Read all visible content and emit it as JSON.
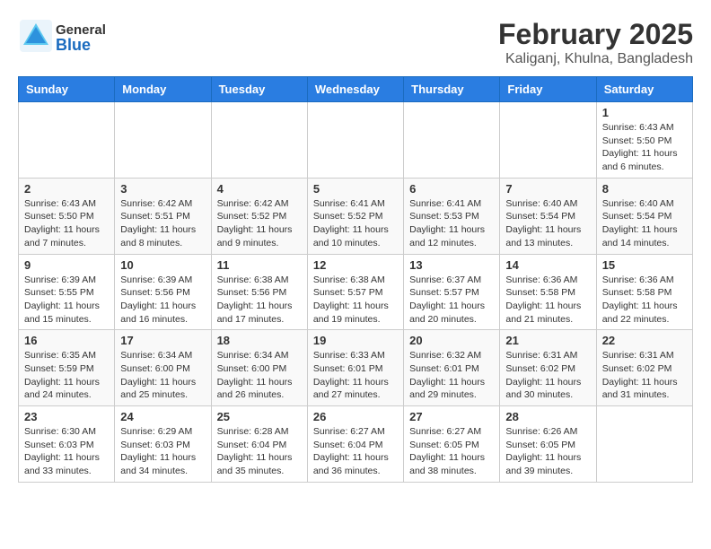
{
  "header": {
    "logo_general": "General",
    "logo_blue": "Blue",
    "main_title": "February 2025",
    "subtitle": "Kaliganj, Khulna, Bangladesh"
  },
  "calendar": {
    "days_of_week": [
      "Sunday",
      "Monday",
      "Tuesday",
      "Wednesday",
      "Thursday",
      "Friday",
      "Saturday"
    ],
    "weeks": [
      [
        {
          "day": "",
          "info": ""
        },
        {
          "day": "",
          "info": ""
        },
        {
          "day": "",
          "info": ""
        },
        {
          "day": "",
          "info": ""
        },
        {
          "day": "",
          "info": ""
        },
        {
          "day": "",
          "info": ""
        },
        {
          "day": "1",
          "info": "Sunrise: 6:43 AM\nSunset: 5:50 PM\nDaylight: 11 hours and 6 minutes."
        }
      ],
      [
        {
          "day": "2",
          "info": "Sunrise: 6:43 AM\nSunset: 5:50 PM\nDaylight: 11 hours and 7 minutes."
        },
        {
          "day": "3",
          "info": "Sunrise: 6:42 AM\nSunset: 5:51 PM\nDaylight: 11 hours and 8 minutes."
        },
        {
          "day": "4",
          "info": "Sunrise: 6:42 AM\nSunset: 5:52 PM\nDaylight: 11 hours and 9 minutes."
        },
        {
          "day": "5",
          "info": "Sunrise: 6:41 AM\nSunset: 5:52 PM\nDaylight: 11 hours and 10 minutes."
        },
        {
          "day": "6",
          "info": "Sunrise: 6:41 AM\nSunset: 5:53 PM\nDaylight: 11 hours and 12 minutes."
        },
        {
          "day": "7",
          "info": "Sunrise: 6:40 AM\nSunset: 5:54 PM\nDaylight: 11 hours and 13 minutes."
        },
        {
          "day": "8",
          "info": "Sunrise: 6:40 AM\nSunset: 5:54 PM\nDaylight: 11 hours and 14 minutes."
        }
      ],
      [
        {
          "day": "9",
          "info": "Sunrise: 6:39 AM\nSunset: 5:55 PM\nDaylight: 11 hours and 15 minutes."
        },
        {
          "day": "10",
          "info": "Sunrise: 6:39 AM\nSunset: 5:56 PM\nDaylight: 11 hours and 16 minutes."
        },
        {
          "day": "11",
          "info": "Sunrise: 6:38 AM\nSunset: 5:56 PM\nDaylight: 11 hours and 17 minutes."
        },
        {
          "day": "12",
          "info": "Sunrise: 6:38 AM\nSunset: 5:57 PM\nDaylight: 11 hours and 19 minutes."
        },
        {
          "day": "13",
          "info": "Sunrise: 6:37 AM\nSunset: 5:57 PM\nDaylight: 11 hours and 20 minutes."
        },
        {
          "day": "14",
          "info": "Sunrise: 6:36 AM\nSunset: 5:58 PM\nDaylight: 11 hours and 21 minutes."
        },
        {
          "day": "15",
          "info": "Sunrise: 6:36 AM\nSunset: 5:58 PM\nDaylight: 11 hours and 22 minutes."
        }
      ],
      [
        {
          "day": "16",
          "info": "Sunrise: 6:35 AM\nSunset: 5:59 PM\nDaylight: 11 hours and 24 minutes."
        },
        {
          "day": "17",
          "info": "Sunrise: 6:34 AM\nSunset: 6:00 PM\nDaylight: 11 hours and 25 minutes."
        },
        {
          "day": "18",
          "info": "Sunrise: 6:34 AM\nSunset: 6:00 PM\nDaylight: 11 hours and 26 minutes."
        },
        {
          "day": "19",
          "info": "Sunrise: 6:33 AM\nSunset: 6:01 PM\nDaylight: 11 hours and 27 minutes."
        },
        {
          "day": "20",
          "info": "Sunrise: 6:32 AM\nSunset: 6:01 PM\nDaylight: 11 hours and 29 minutes."
        },
        {
          "day": "21",
          "info": "Sunrise: 6:31 AM\nSunset: 6:02 PM\nDaylight: 11 hours and 30 minutes."
        },
        {
          "day": "22",
          "info": "Sunrise: 6:31 AM\nSunset: 6:02 PM\nDaylight: 11 hours and 31 minutes."
        }
      ],
      [
        {
          "day": "23",
          "info": "Sunrise: 6:30 AM\nSunset: 6:03 PM\nDaylight: 11 hours and 33 minutes."
        },
        {
          "day": "24",
          "info": "Sunrise: 6:29 AM\nSunset: 6:03 PM\nDaylight: 11 hours and 34 minutes."
        },
        {
          "day": "25",
          "info": "Sunrise: 6:28 AM\nSunset: 6:04 PM\nDaylight: 11 hours and 35 minutes."
        },
        {
          "day": "26",
          "info": "Sunrise: 6:27 AM\nSunset: 6:04 PM\nDaylight: 11 hours and 36 minutes."
        },
        {
          "day": "27",
          "info": "Sunrise: 6:27 AM\nSunset: 6:05 PM\nDaylight: 11 hours and 38 minutes."
        },
        {
          "day": "28",
          "info": "Sunrise: 6:26 AM\nSunset: 6:05 PM\nDaylight: 11 hours and 39 minutes."
        },
        {
          "day": "",
          "info": ""
        }
      ]
    ]
  }
}
